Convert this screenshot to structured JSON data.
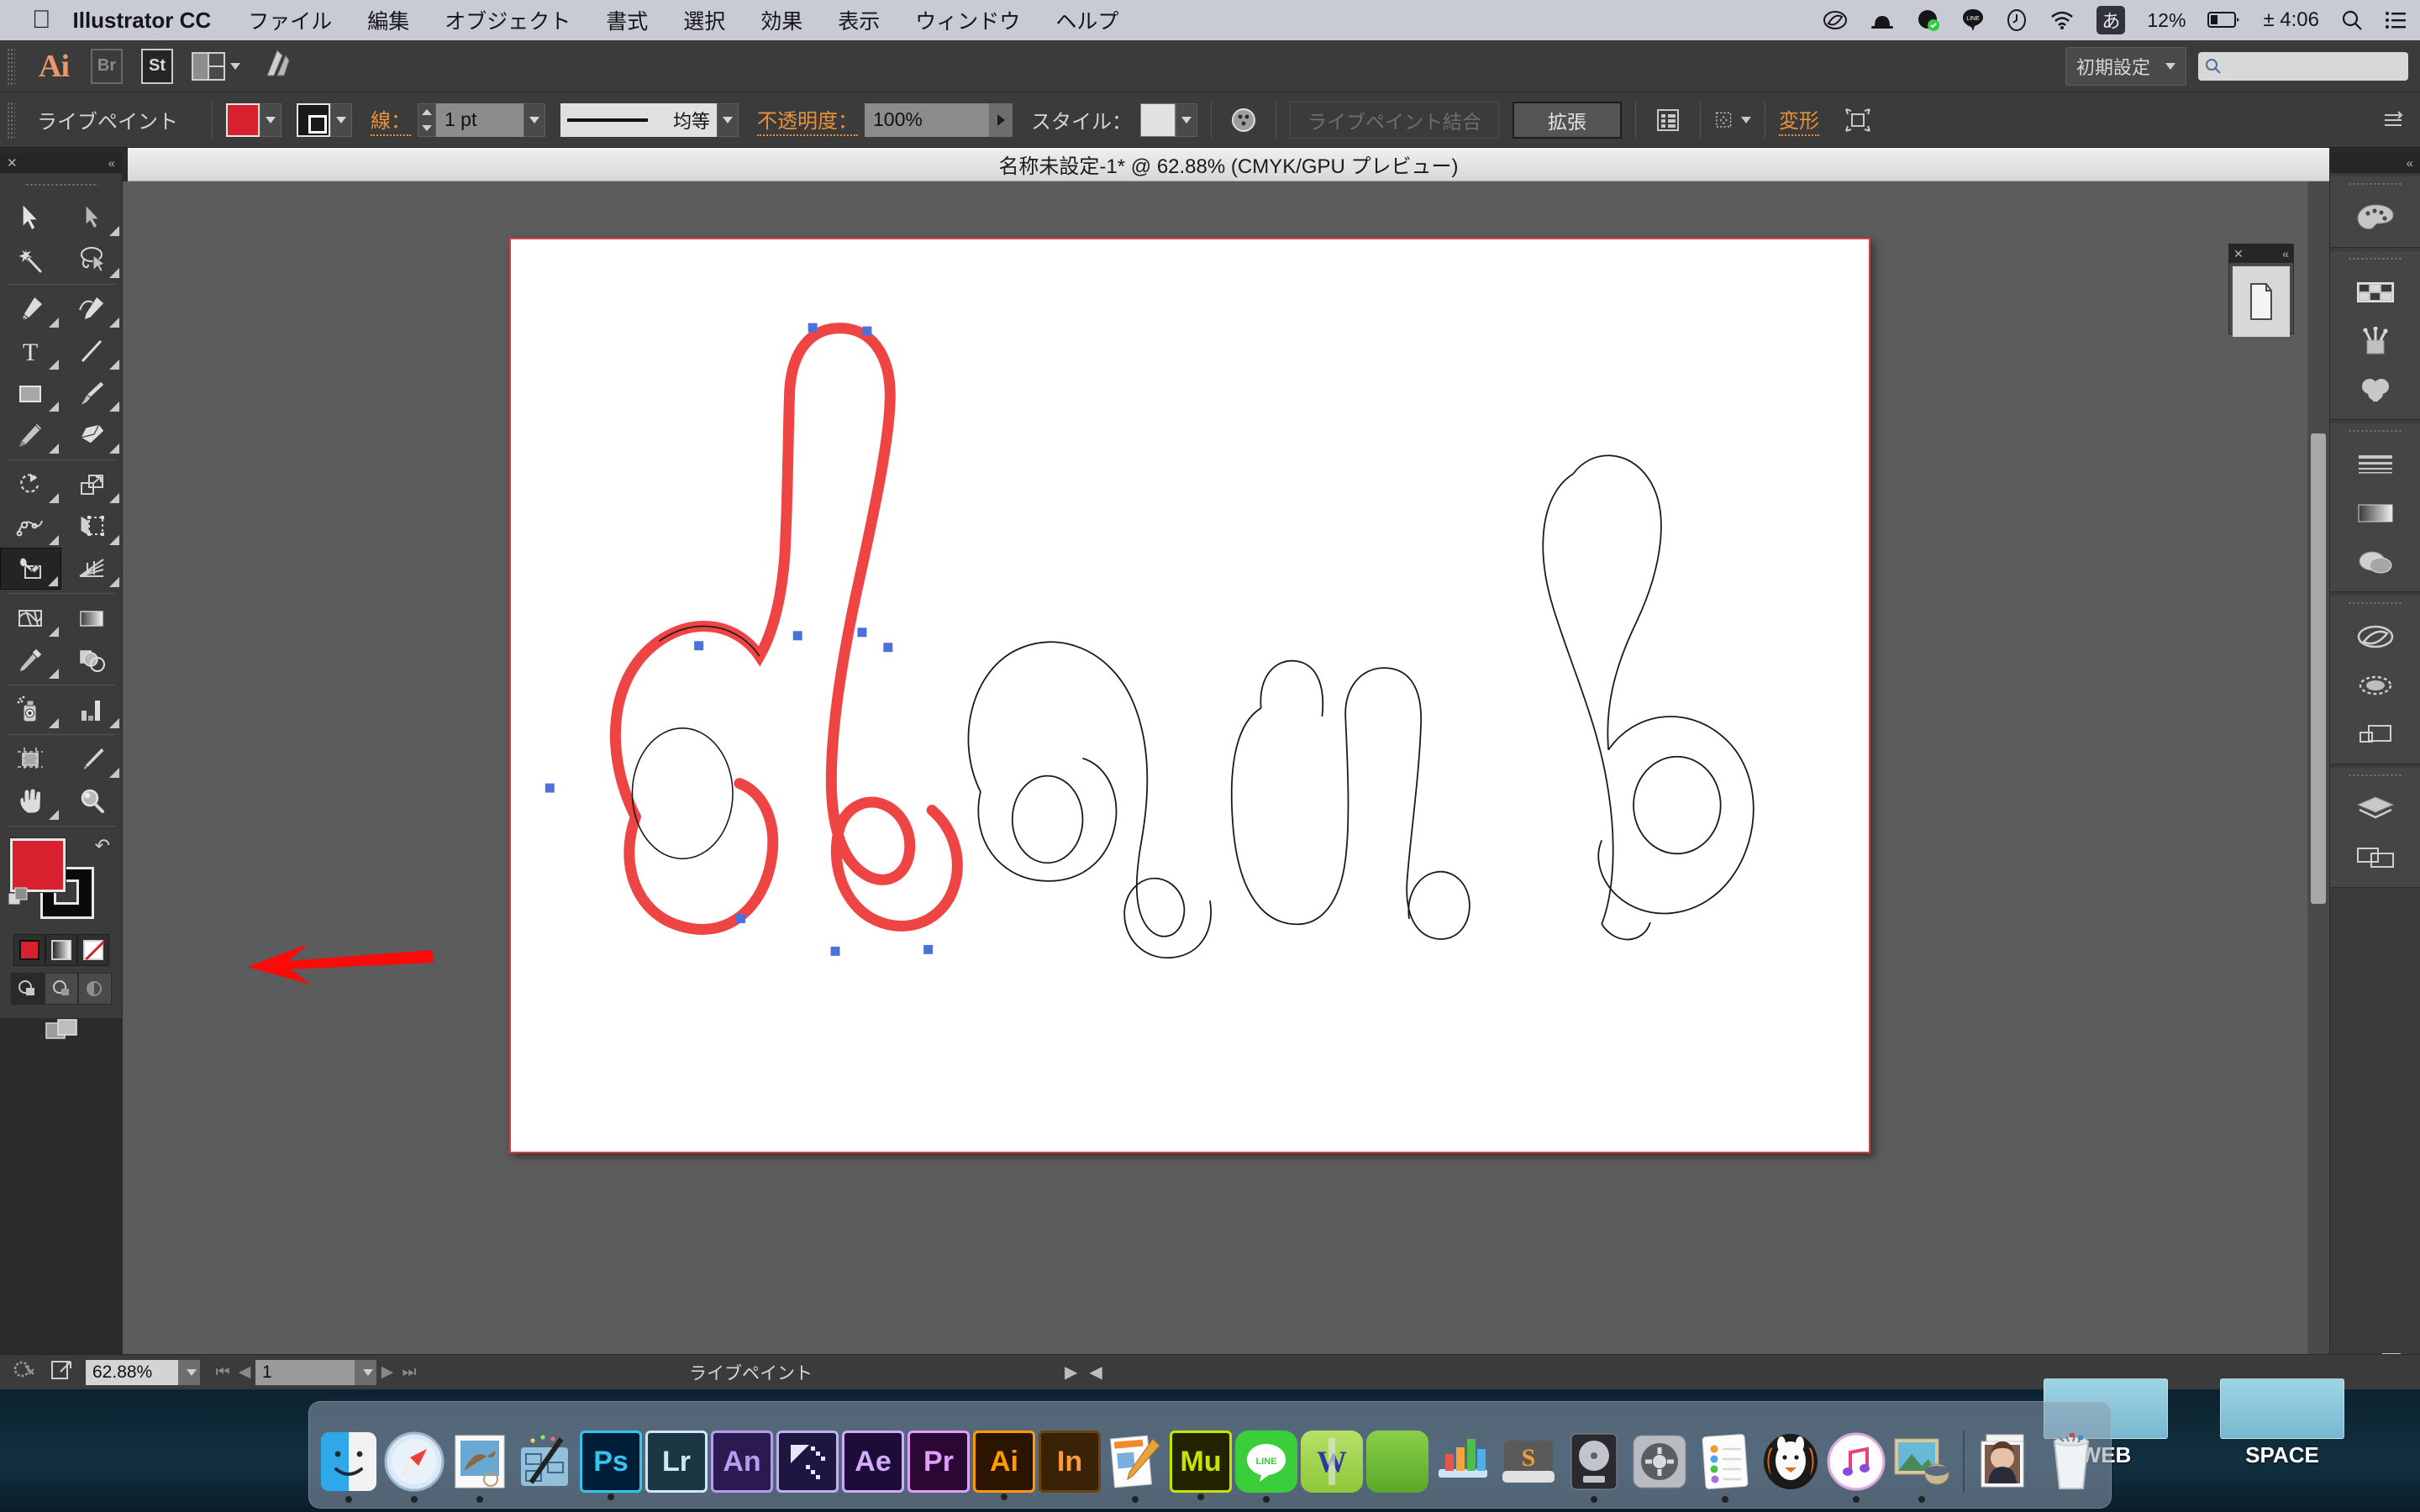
{
  "menubar": {
    "apple_icon": "apple-icon",
    "app_name": "Illustrator CC",
    "items": [
      "ファイル",
      "編集",
      "オブジェクト",
      "書式",
      "選択",
      "効果",
      "表示",
      "ウィンドウ",
      "ヘルプ"
    ],
    "status_icons": [
      "creative-cloud-icon",
      "scanner-icon",
      "dropbox-sync-icon",
      "line-icon",
      "clock-icon",
      "wifi-icon"
    ],
    "ime": "あ",
    "battery_percent": "12%",
    "time": "± 4:06",
    "search_icon": "spotlight-search-icon",
    "notification_icon": "notification-center-icon"
  },
  "appbar": {
    "logo": "Ai",
    "bridge_label": "Br",
    "stock_label": "St",
    "arrange_docs": "arrange-documents-icon",
    "stock_icon": "adobe-stock-icon",
    "workspace": "初期設定",
    "search_placeholder": ""
  },
  "controlbar": {
    "tool_label": "ライブペイント",
    "fill_color": "#d8202f",
    "stroke_label": "線：",
    "stroke_weight": "1 pt",
    "stroke_profile": "均等",
    "opacity_label": "不透明度：",
    "opacity_value": "100%",
    "style_label": "スタイル：",
    "recolor_icon": "recolor-artwork-icon",
    "merge_button": "ライブペイント結合",
    "expand_button": "拡張",
    "align_icon": "align-panel-icon",
    "select_similar_icon": "select-similar-icon",
    "transform_label": "変形",
    "isolate_icon": "isolate-selected-icon",
    "overflow_icon": "panel-overflow-icon"
  },
  "document": {
    "tab_title": "名称未設定-1* @ 62.88% (CMYK/GPU プレビュー)"
  },
  "toolbar": {
    "close_icon": "close-panel-icon",
    "collapse_icon": "collapse-panel-icon",
    "tools": [
      {
        "name": "selection-tool",
        "glyph": "selection-arrow"
      },
      {
        "name": "direct-selection-tool",
        "glyph": "direct-arrow"
      },
      {
        "name": "magic-wand-tool",
        "glyph": "magic-wand"
      },
      {
        "name": "lasso-tool",
        "glyph": "lasso"
      },
      {
        "name": "pen-tool",
        "glyph": "pen"
      },
      {
        "name": "curvature-tool",
        "glyph": "curvature-pen"
      },
      {
        "name": "type-tool",
        "glyph": "T"
      },
      {
        "name": "line-segment-tool",
        "glyph": "line"
      },
      {
        "name": "rectangle-tool",
        "glyph": "rectangle"
      },
      {
        "name": "paintbrush-tool",
        "glyph": "paintbrush"
      },
      {
        "name": "pencil-tool",
        "glyph": "pencil"
      },
      {
        "name": "eraser-tool",
        "glyph": "eraser"
      },
      {
        "name": "rotate-tool",
        "glyph": "rotate"
      },
      {
        "name": "scale-tool",
        "glyph": "scale"
      },
      {
        "name": "width-tool",
        "glyph": "width"
      },
      {
        "name": "free-transform-tool",
        "glyph": "free-transform"
      },
      {
        "name": "live-paint-bucket-tool",
        "glyph": "paint-bucket",
        "selected": true
      },
      {
        "name": "perspective-grid-tool",
        "glyph": "perspective-grid"
      },
      {
        "name": "shape-builder-tool",
        "glyph": "shape-builder"
      },
      {
        "name": "gradient-tool",
        "glyph": "gradient"
      },
      {
        "name": "eyedropper-tool",
        "glyph": "eyedropper"
      },
      {
        "name": "blend-tool",
        "glyph": "blend"
      },
      {
        "name": "symbol-sprayer-tool",
        "glyph": "symbol-sprayer"
      },
      {
        "name": "column-graph-tool",
        "glyph": "bar-graph"
      },
      {
        "name": "artboard-tool",
        "glyph": "artboard"
      },
      {
        "name": "slice-tool",
        "glyph": "slice-knife"
      },
      {
        "name": "hand-tool",
        "glyph": "hand"
      },
      {
        "name": "zoom-tool",
        "glyph": "magnifier"
      }
    ],
    "fill_color": "#d8202f",
    "stroke_color": "#000000",
    "swap_icon": "swap-fill-stroke-icon",
    "default_icon": "default-fill-stroke-icon",
    "color_modes": [
      "color-swatch-button",
      "gradient-button",
      "none-button"
    ],
    "draw_modes": [
      "draw-normal",
      "draw-behind",
      "draw-inside"
    ],
    "screen_mode": "change-screen-mode-icon"
  },
  "artwork": {
    "text": "daub",
    "selected_letter": "d",
    "selection_stroke": "#ef4444",
    "anchor_color": "#4a72d8",
    "outline_color": "#1a1a1a",
    "annotation": "red-arrow-pointing-to-fill-swatch"
  },
  "rightdock": {
    "collapse_icon": "collapse-panels-icon",
    "groups": [
      {
        "items": [
          {
            "name": "color-panel-icon"
          }
        ]
      },
      {
        "items": [
          {
            "name": "swatches-panel-icon"
          },
          {
            "name": "brushes-panel-icon"
          },
          {
            "name": "symbols-panel-icon"
          }
        ]
      },
      {
        "items": [
          {
            "name": "stroke-panel-icon"
          },
          {
            "name": "gradient-panel-icon"
          },
          {
            "name": "transparency-panel-icon"
          }
        ]
      },
      {
        "items": [
          {
            "name": "libraries-panel-icon"
          },
          {
            "name": "appearance-panel-icon"
          },
          {
            "name": "graphic-styles-panel-icon"
          }
        ]
      },
      {
        "items": [
          {
            "name": "layers-panel-icon"
          },
          {
            "name": "artboards-panel-icon"
          }
        ]
      }
    ],
    "trash_icon": "delete-panel-icon"
  },
  "minipanel": {
    "close_icon": "close-icon",
    "collapse_icon": "collapse-icon",
    "body_icon": "artboard-thumb-icon"
  },
  "statusbar": {
    "preferences_icon": "preflight-icon",
    "share_icon": "share-document-icon",
    "zoom_value": "62.88%",
    "page_value": "1",
    "status_text": "ライブペイント"
  },
  "dock": {
    "items": [
      {
        "name": "finder",
        "label": "",
        "kind": "finder",
        "running": true
      },
      {
        "name": "safari",
        "label": "",
        "kind": "safari",
        "running": true
      },
      {
        "name": "mail",
        "label": "",
        "kind": "mail",
        "running": true
      },
      {
        "name": "omnigraffle",
        "label": "",
        "kind": "graffle",
        "running": false
      },
      {
        "name": "photoshop",
        "label": "Ps",
        "kind": "adobe",
        "color": "#31c5f0",
        "bg": "#001e36",
        "running": true
      },
      {
        "name": "lightroom",
        "label": "Lr",
        "kind": "adobe",
        "color": "#cfe8f6",
        "bg": "#1d3644",
        "running": false
      },
      {
        "name": "animate",
        "label": "An",
        "kind": "adobe",
        "color": "#b69cf0",
        "bg": "#2a1a50",
        "running": false
      },
      {
        "name": "dreamweaver-fireworks",
        "label": "",
        "kind": "fw",
        "running": false
      },
      {
        "name": "aftereffects",
        "label": "Ae",
        "kind": "adobe",
        "color": "#d3aaff",
        "bg": "#1d0c38",
        "running": false
      },
      {
        "name": "premiere",
        "label": "Pr",
        "kind": "adobe",
        "color": "#e29bff",
        "bg": "#2a0833",
        "running": false
      },
      {
        "name": "illustrator",
        "label": "Ai",
        "kind": "adobe",
        "color": "#ff9a00",
        "bg": "#2b1400",
        "running": true
      },
      {
        "name": "indesign",
        "label": "In",
        "kind": "adobe",
        "color": "#f89c3c",
        "bg": "#3a2207",
        "running": false
      },
      {
        "name": "pages",
        "label": "",
        "kind": "pages",
        "running": true
      },
      {
        "name": "muse",
        "label": "Mu",
        "kind": "adobe",
        "color": "#c3e500",
        "bg": "#232300",
        "running": true
      },
      {
        "name": "line",
        "label": "LINE",
        "kind": "line",
        "running": true
      },
      {
        "name": "winzip",
        "label": "W",
        "kind": "winzip",
        "running": false
      },
      {
        "name": "keynote",
        "label": "",
        "kind": "keynote",
        "running": false
      },
      {
        "name": "numbers",
        "label": "",
        "kind": "numbers",
        "running": false
      },
      {
        "name": "superduper",
        "label": "S",
        "kind": "superduper",
        "running": false
      },
      {
        "name": "logic",
        "label": "",
        "kind": "logic",
        "running": true
      },
      {
        "name": "system-preferences",
        "label": "",
        "kind": "sysprefs",
        "running": false
      },
      {
        "name": "reminders",
        "label": "",
        "kind": "reminders",
        "running": true
      },
      {
        "name": "mamp",
        "label": "",
        "kind": "mamp",
        "running": false
      },
      {
        "name": "itunes",
        "label": "",
        "kind": "itunes",
        "running": true
      },
      {
        "name": "photos",
        "label": "",
        "kind": "photos",
        "running": true
      },
      {
        "name": "photo-stack",
        "label": "",
        "kind": "photostack",
        "running": false
      },
      {
        "name": "trash",
        "label": "",
        "kind": "trash",
        "running": false
      }
    ]
  },
  "desktop": {
    "icons": [
      {
        "name": "desktop-icon-web",
        "label": "WEB"
      },
      {
        "name": "desktop-icon-space",
        "label": "SPACE"
      }
    ]
  }
}
